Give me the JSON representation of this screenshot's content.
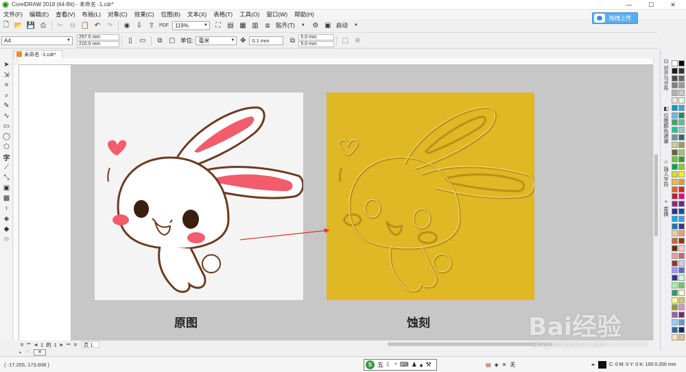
{
  "window": {
    "title": "CorelDRAW 2018 (64-Bit) - 未命名 -1.cdr*",
    "min": "—",
    "max": "☐",
    "close": "✕"
  },
  "menu": [
    "文件(F)",
    "编辑(E)",
    "查看(V)",
    "布局(L)",
    "对象(C)",
    "效果(C)",
    "位图(B)",
    "文本(X)",
    "表格(T)",
    "工具(O)",
    "窗口(W)",
    "帮助(H)"
  ],
  "upload_button": "拖拽上传",
  "toolbar": {
    "zoom": "119%",
    "snap_label": "贴齐(T)",
    "launch_label": "启动"
  },
  "property_bar": {
    "page_size": "A4",
    "width": "297.0 mm",
    "height": "210.0 mm",
    "unit_label": "单位:",
    "unit_value": "毫米",
    "nudge": "0.1 mm",
    "dup_x": "5.0 mm",
    "dup_y": "5.0 mm"
  },
  "doc_tab": "未命名 -1.cdr*",
  "page_nav": {
    "current": "1",
    "of": "的",
    "total": "1",
    "page_tab": "页 1"
  },
  "captions": {
    "left": "原图",
    "right": "蚀刻"
  },
  "status": {
    "coords": "( -17.205, 173.608 )",
    "ime_text": "五",
    "fill_none": "无",
    "color_info": "C: 0 M: 0 Y: 0 K: 100  0.200 mm"
  },
  "dockers": [
    {
      "icon": "⊡",
      "label": "对齐与分布"
    },
    {
      "icon": "◧",
      "label": "位图颜色遮罩"
    },
    {
      "icon": "☆",
      "label": "插入字符"
    },
    {
      "icon": "⚬",
      "label": "变换"
    }
  ],
  "watermark": {
    "brand": "Bai经验",
    "url": "jingyan.baidu.com"
  },
  "colors": {
    "etch_gold": "#e0b724",
    "rabbit_outline": "#6b3a1f",
    "cheek_pink": "#f25c6b",
    "selection_arrow": "#e0312b"
  },
  "palette_colors": [
    "#ffffff",
    "#000000",
    "#1a1a1a",
    "#333333",
    "#4d4d4d",
    "#666666",
    "#808080",
    "#999999",
    "#b3b3b3",
    "#cccccc",
    "#e6e6e6",
    "#f2f2f2",
    "#0099cc",
    "#33aadd",
    "#66bbee",
    "#009966",
    "#33aa77",
    "#66bb99",
    "#00cc99",
    "#99cccc",
    "#669999",
    "#336666",
    "#cccc99",
    "#999966",
    "#666633",
    "#99cc66",
    "#66cc33",
    "#339933",
    "#00a651",
    "#8dc63f",
    "#d7df23",
    "#fff200",
    "#fbb040",
    "#f7941d",
    "#f15a29",
    "#ed1c24",
    "#be1e2d",
    "#ec008c",
    "#92278f",
    "#662d91",
    "#2e3192",
    "#0054a6",
    "#00aeef",
    "#27aae1",
    "#1c75bc",
    "#2b3990",
    "#ffcc99",
    "#ff9966",
    "#cc6633",
    "#993300",
    "#663300",
    "#ffcccc",
    "#ff9999",
    "#cc6666",
    "#993333",
    "#ccccff",
    "#9999ff",
    "#6666cc",
    "#333399",
    "#ccffcc",
    "#99ff99",
    "#66cc66",
    "#339966",
    "#ffffcc",
    "#ffff99",
    "#cccc66",
    "#999933",
    "#cc99cc",
    "#996699",
    "#663366",
    "#99ccff",
    "#6699cc",
    "#336699",
    "#003366",
    "#ffe6b3",
    "#e6c280"
  ]
}
